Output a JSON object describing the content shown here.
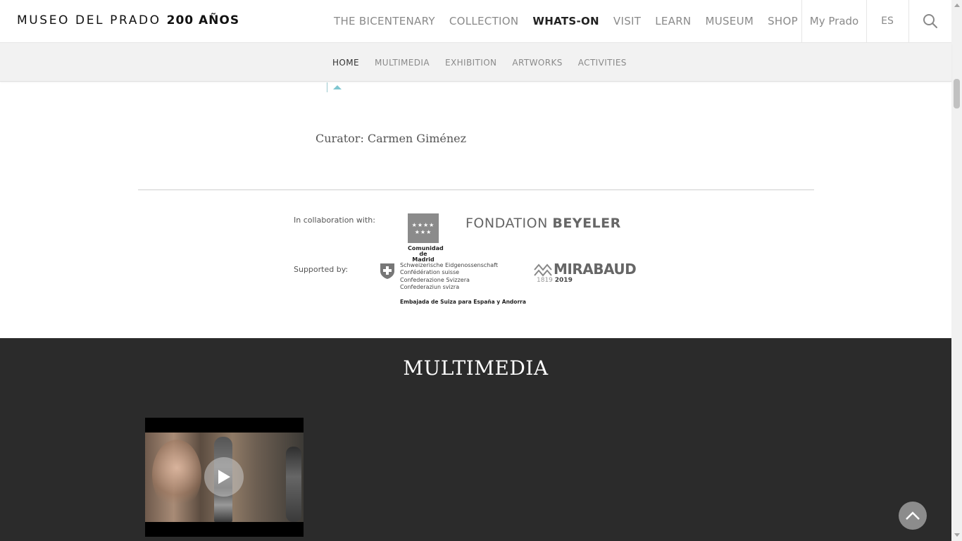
{
  "header": {
    "logo_text": "MUSEO DEL PRADO",
    "logo_bold": "200 AÑOS",
    "nav": [
      {
        "label": "THE BICENTENARY"
      },
      {
        "label": "COLLECTION"
      },
      {
        "label": "WHATS-ON"
      },
      {
        "label": "VISIT"
      },
      {
        "label": "LEARN"
      },
      {
        "label": "MUSEUM"
      },
      {
        "label": "SHOP"
      }
    ],
    "active_nav": "WHATS-ON",
    "my_prado": "My Prado",
    "language": "ES",
    "search_icon": "search-icon"
  },
  "subnav": {
    "items": [
      {
        "label": "HOME"
      },
      {
        "label": "MULTIMEDIA"
      },
      {
        "label": "EXHIBITION"
      },
      {
        "label": "ARTWORKS"
      },
      {
        "label": "ACTIVITIES"
      }
    ],
    "active": "HOME"
  },
  "content": {
    "curator_label": "Curator:",
    "curator_name": "Carmen Giménez",
    "collab_label": "In collaboration with:",
    "supported_label": "Supported by:",
    "madrid_stars": "★★★★ ★★★",
    "madrid_name_1": "Comunidad",
    "madrid_name_2": "de Madrid",
    "beyeler_light": "FONDATION",
    "beyeler_bold": "BEYELER",
    "swiss_lines": [
      "Schweizerische Eidgenossenschaft",
      "Confédération suisse",
      "Confederazione Svizzera",
      "Confederaziun svizra"
    ],
    "swiss_embassy": "Embajada de Suiza para España y Andorra",
    "mirabaud_name": "MIRABAUD",
    "mirabaud_year_start": "1819",
    "mirabaud_year_end": "2019"
  },
  "multimedia": {
    "title": "MULTIMEDIA",
    "play_icon": "play-icon"
  },
  "colors": {
    "accent": "#7fc6d0",
    "dark_section": "#2b2b2b",
    "subnav_bg": "#f2f2f2"
  }
}
